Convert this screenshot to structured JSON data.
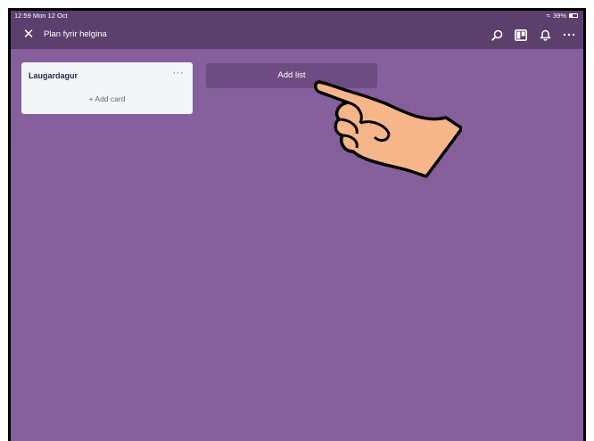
{
  "status_bar": {
    "time": "12:59  Mon 12 Oct",
    "battery_text": "39%",
    "battery_level": 0.39
  },
  "header": {
    "close_icon": "close-icon",
    "board_title": "Plan fyrir helgina",
    "actions": [
      "search-icon",
      "board-view-icon",
      "notification-bell-icon",
      "more-options-icon"
    ]
  },
  "lists": [
    {
      "title": "Laugardagur",
      "menu_glyph": "···",
      "add_card_label": "+ Add card"
    }
  ],
  "add_list_label": "Add list",
  "colors": {
    "board_background": "#85609c",
    "header_background": "#5b3f6d",
    "add_list_background": "#6d4c82",
    "list_background": "#f4f5f7",
    "hand_fill": "#f7b58a"
  }
}
